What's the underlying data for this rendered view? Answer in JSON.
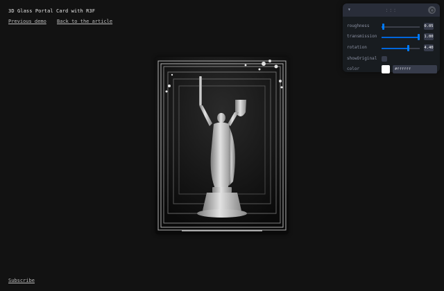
{
  "header": {
    "title": "3D Glass Portal Card with R3F",
    "links": [
      "Previous demo",
      "Back to the article"
    ]
  },
  "footer": {
    "subscribe": "Subscribe"
  },
  "panel": {
    "grip": ":::",
    "controls": [
      {
        "label": "roughness",
        "value": "0.05",
        "fraction": 0.05
      },
      {
        "label": "transmission",
        "value": "1.00",
        "fraction": 1.0
      },
      {
        "label": "rotation",
        "value": "4.40",
        "fraction": 0.7
      }
    ],
    "checkbox": {
      "label": "showOriginal",
      "checked": false
    },
    "color": {
      "label": "color",
      "hex": "#ffffff"
    }
  },
  "colors": {
    "accent": "#007bff",
    "panel_bg": "#181c20",
    "page_bg": "#121212"
  }
}
